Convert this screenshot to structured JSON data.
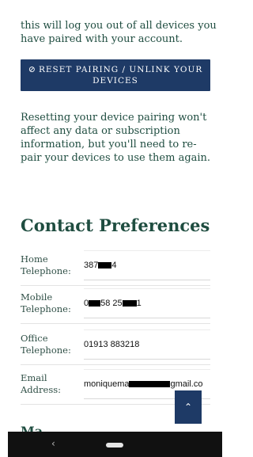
{
  "intro_text": "this will log you out of all devices you have paired with your account.",
  "reset_button": {
    "icon": "ban-icon",
    "label": "RESET PAIRING / UNLINK YOUR DEVICES"
  },
  "note_text": "Resetting your device pairing won't affect any data or subscription information, but you'll need to re-pair your devices to use them again.",
  "section_title": "Contact Preferences",
  "contacts": [
    {
      "label": "Home Telephone:",
      "value_parts": [
        "387",
        "4"
      ]
    },
    {
      "label": "Mobile Telephone:",
      "value_parts": [
        "0",
        "58 25",
        "1"
      ]
    },
    {
      "label": "Office Telephone:",
      "value_parts": [
        "01913 883218"
      ]
    },
    {
      "label": "Email Address:",
      "value_parts": [
        "moniquema",
        "gmail.co"
      ]
    }
  ],
  "next_heading": "Ma",
  "scroll_top_icon": "chevron-up-icon",
  "nav": {
    "back_icon": "back-icon",
    "home_icon": "home-pill-icon"
  }
}
